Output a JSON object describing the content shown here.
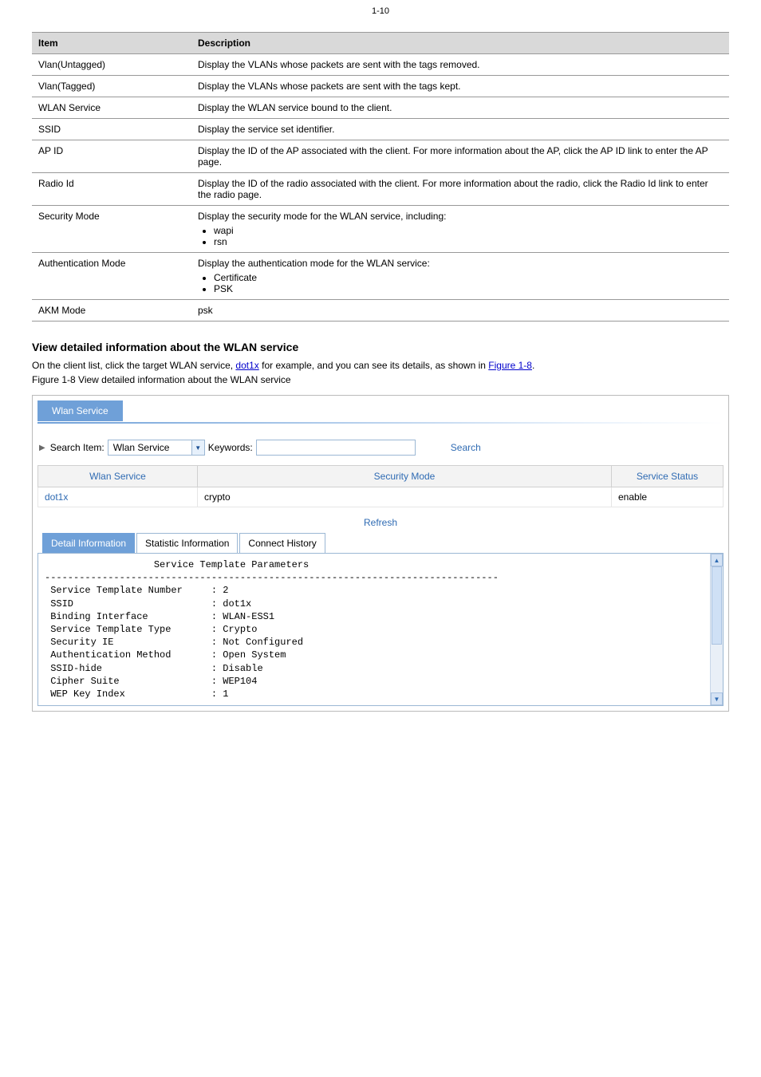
{
  "page_number": "1-10",
  "config_table": {
    "headers": [
      "Item",
      "Description"
    ],
    "rows": [
      {
        "item": "Vlan(Untagged)",
        "desc": "Display the VLANs whose packets are sent with the tags removed."
      },
      {
        "item": "Vlan(Tagged)",
        "desc": "Display the VLANs whose packets are sent with the tags kept."
      },
      {
        "item": "WLAN Service",
        "desc": "Display the WLAN service bound to the client."
      },
      {
        "item": "SSID",
        "desc": "Display the service set identifier."
      },
      {
        "item": "AP ID",
        "desc": "Display the ID of the AP associated with the client. For more information about the AP, click the AP ID link to enter the AP page."
      },
      {
        "item": "Radio Id",
        "desc": "Display the ID of the radio associated with the client. For more information about the radio, click the Radio Id link to enter the radio page."
      },
      {
        "item": "Security Mode",
        "desc_pre": "Display the security mode for the WLAN service, including:",
        "list": [
          "wapi",
          "rsn"
        ]
      },
      {
        "item": "Authentication Mode",
        "desc_pre": "Display the authentication mode for the WLAN service:",
        "list": [
          "Certificate",
          "PSK"
        ]
      },
      {
        "item": "AKM Mode",
        "desc": "psk"
      }
    ]
  },
  "section_heading": "View detailed information about the WLAN service",
  "intro_pre": "On the client list, click the target WLAN service, ",
  "intro_link1": "dot1x",
  "intro_mid": " for example, and you can see its details, as shown in ",
  "intro_link2": "Figure 1-8",
  "intro_post": ".",
  "figure_caption": "Figure 1-8 View detailed information about the WLAN service",
  "screenshot": {
    "tab_label": "Wlan Service",
    "search_item_label": "Search Item:",
    "search_select_value": "Wlan Service",
    "keywords_label": "Keywords:",
    "keywords_value": "",
    "search_button": "Search",
    "grid_headers": [
      "Wlan Service",
      "Security Mode",
      "Service Status"
    ],
    "grid_row": {
      "wlan_service": "dot1x",
      "security_mode": "crypto",
      "service_status": "enable"
    },
    "refresh": "Refresh",
    "detail_tabs": [
      "Detail Information",
      "Statistic Information",
      "Connect History"
    ],
    "detail_title": "Service Template Parameters",
    "detail_sep": "-------------------------------------------------------------------------------",
    "detail_lines": [
      {
        "k": "Service Template Number",
        "v": "2"
      },
      {
        "k": "SSID",
        "v": "dot1x"
      },
      {
        "k": "Binding Interface",
        "v": "WLAN-ESS1"
      },
      {
        "k": "Service Template Type",
        "v": "Crypto"
      },
      {
        "k": "Security IE",
        "v": "Not Configured"
      },
      {
        "k": "Authentication Method",
        "v": "Open System"
      },
      {
        "k": "SSID-hide",
        "v": "Disable"
      },
      {
        "k": "Cipher Suite",
        "v": "WEP104"
      },
      {
        "k": "WEP Key Index",
        "v": "1"
      }
    ]
  }
}
